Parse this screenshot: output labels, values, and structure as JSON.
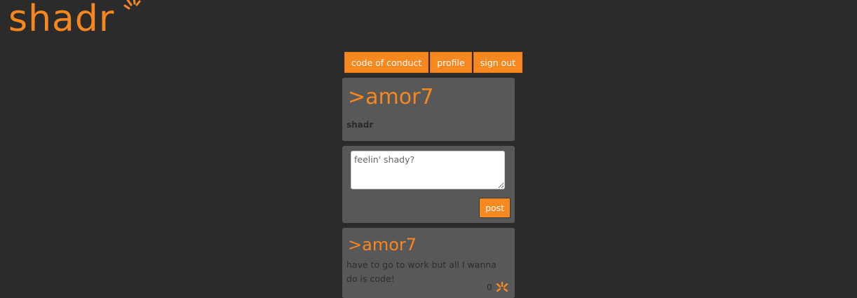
{
  "brand": {
    "name": "shadr",
    "accent_color": "#f7871f",
    "background_color": "#2b2b2b",
    "card_color": "#585858",
    "logo_icon": "sunburst-icon"
  },
  "nav": {
    "code_of_conduct": "code of conduct",
    "profile": "profile",
    "sign_out": "sign out"
  },
  "profile_card": {
    "handle": ">amor7",
    "subtitle": "shadr"
  },
  "composer": {
    "placeholder": "feelin' shady?",
    "value": "",
    "post_label": "post"
  },
  "posts": [
    {
      "handle": ">amor7",
      "body": "have to go to work but all I wanna do is code!",
      "like_count": "0",
      "like_icon": "sunburst-icon"
    }
  ]
}
